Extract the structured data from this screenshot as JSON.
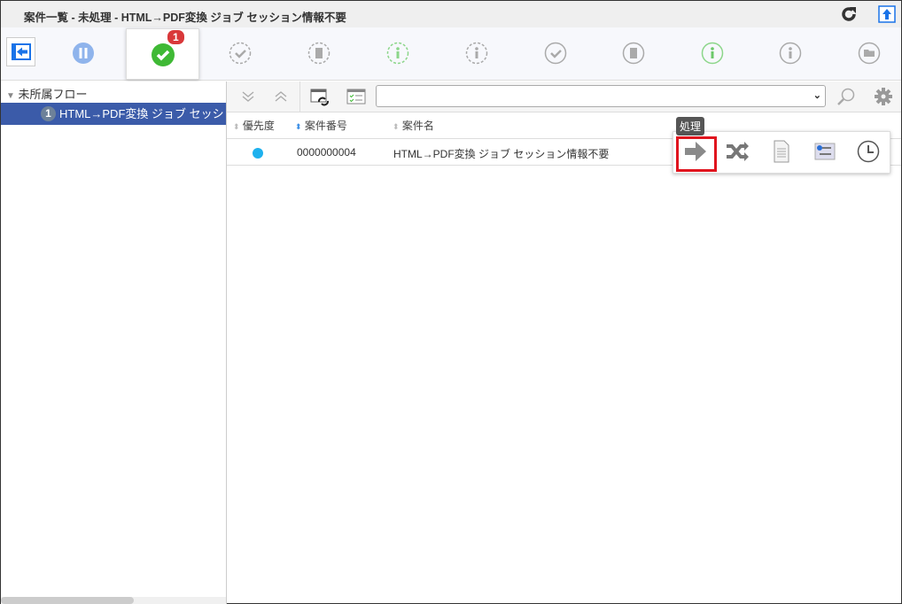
{
  "title": "案件一覧 - 未処理 - HTML→PDF変換 ジョブ セッション情報不要",
  "badge_count": "1",
  "tree": {
    "root": "未所属フロー",
    "selected_count": "1",
    "selected_label": "HTML→PDF変換 ジョブ セッション情報不要"
  },
  "columns": [
    "優先度",
    "案件番号",
    "案件名"
  ],
  "rows": [
    {
      "priority_color": "#1eb1ee",
      "number": "0000000004",
      "name": "HTML→PDF変換 ジョブ セッション情報不要"
    }
  ],
  "tooltip": "処理",
  "filter_select": {
    "value": ""
  }
}
